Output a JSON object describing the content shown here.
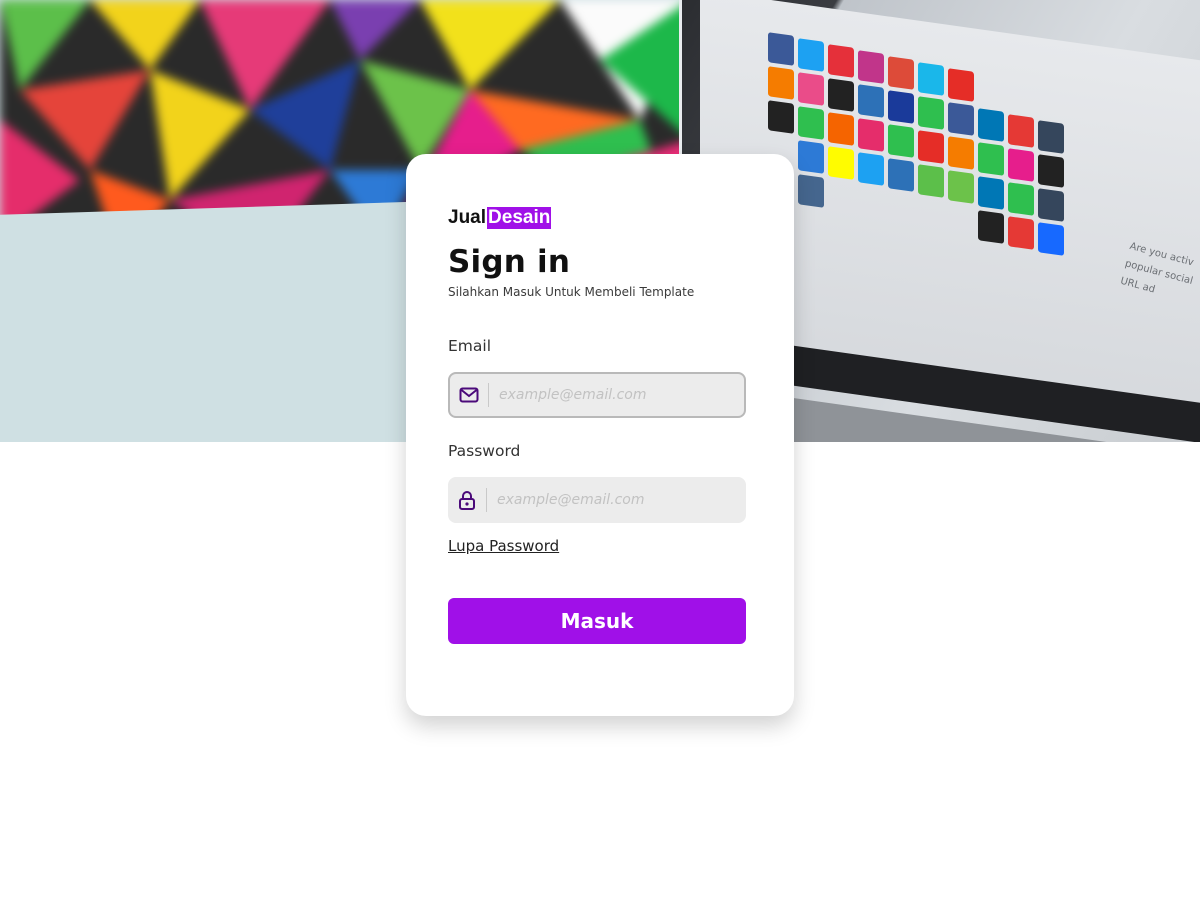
{
  "theme": {
    "accent": "#a010e8",
    "icon_color": "#4b0a7a"
  },
  "hero": {
    "background_image": "blurred colorful geometric monitor and laptop showing social media icon grid",
    "side_text_lines": [
      "Are you activ",
      "popular social",
      "URL ad"
    ]
  },
  "brand": {
    "name_part1": "Jual",
    "name_part2": "Desain"
  },
  "signin": {
    "title": "Sign in",
    "subtitle": "Silahkan Masuk Untuk Membeli Template",
    "email": {
      "label": "Email",
      "placeholder": "example@email.com",
      "icon": "mail-icon",
      "value": ""
    },
    "password": {
      "label": "Password",
      "placeholder": "example@email.com",
      "icon": "lock-icon",
      "value": ""
    },
    "forgot_label": "Lupa Password",
    "submit_label": "Masuk"
  }
}
